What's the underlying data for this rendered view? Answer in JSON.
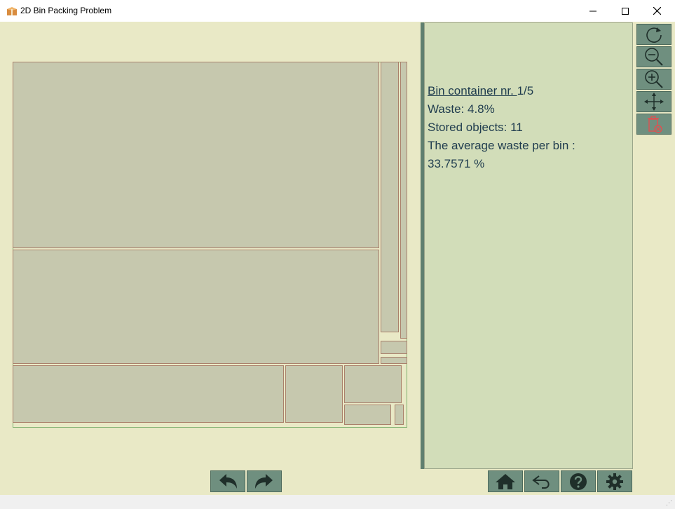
{
  "window": {
    "title": "2D Bin Packing Problem",
    "controls": [
      "minimize",
      "maximize",
      "close"
    ]
  },
  "info": {
    "bin_label": "Bin container nr. ",
    "bin_index": "1/5",
    "waste": "Waste: 4.8%",
    "stored": "Stored objects: 11",
    "avg_label": "The average waste per bin :",
    "avg_value": "33.7571 %"
  },
  "toolbar_side": [
    {
      "name": "refresh-icon"
    },
    {
      "name": "zoom-out-icon"
    },
    {
      "name": "zoom-in-icon"
    },
    {
      "name": "fit-icon"
    },
    {
      "name": "delete-icon"
    }
  ],
  "toolbar_bottom": [
    {
      "name": "undo-icon"
    },
    {
      "name": "redo-icon"
    },
    {
      "name": "home-icon"
    },
    {
      "name": "back-icon"
    },
    {
      "name": "help-icon"
    },
    {
      "name": "settings-icon"
    }
  ],
  "colors": {
    "item_fill": "#c6c8ae",
    "item_stroke": "#a9806b",
    "bin_stroke": "#7fb06f",
    "button_bg": "#6f8f7f",
    "text": "#1f3c4e",
    "info_bg": "#d2ddb9",
    "canvas_bg": "#e9e9c6"
  }
}
